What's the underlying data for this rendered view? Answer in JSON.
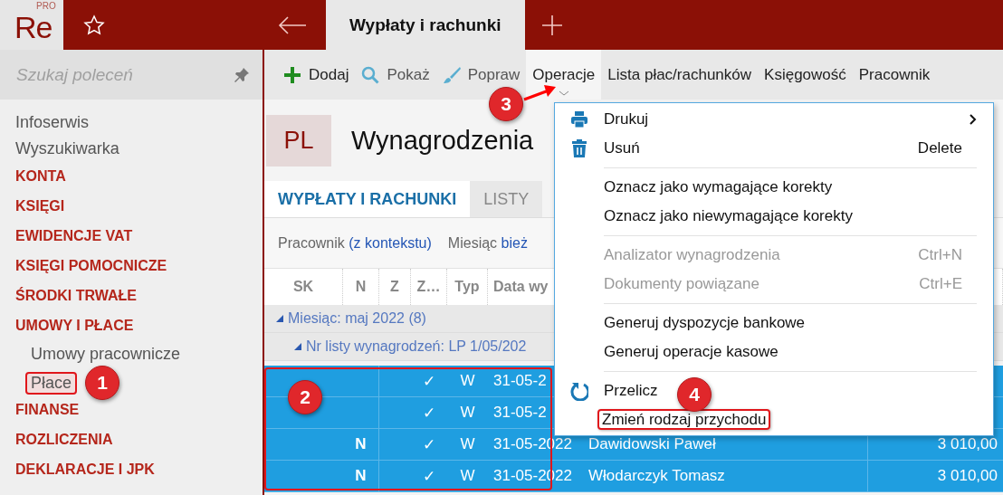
{
  "app": {
    "logo": "Re",
    "logo_badge": "PRO"
  },
  "tabs": [
    {
      "label": "Wypłaty i rachunki",
      "selected": true
    }
  ],
  "sidebar": {
    "search": {
      "placeholder": "Szukaj poleceń"
    },
    "items": [
      {
        "label": "Infoserwis",
        "kind": "link"
      },
      {
        "label": "Wyszukiwarka",
        "kind": "link"
      },
      {
        "label": "KONTA",
        "kind": "section"
      },
      {
        "label": "KSIĘGI",
        "kind": "section"
      },
      {
        "label": "EWIDENCJE VAT",
        "kind": "section"
      },
      {
        "label": "KSIĘGI POMOCNICZE",
        "kind": "section"
      },
      {
        "label": "ŚRODKI TRWAŁE",
        "kind": "section"
      },
      {
        "label": "UMOWY I PŁACE",
        "kind": "section",
        "children": [
          {
            "label": "Umowy pracownicze",
            "selected": false
          },
          {
            "label": "Płace",
            "selected": true
          }
        ]
      },
      {
        "label": "FINANSE",
        "kind": "section"
      },
      {
        "label": "ROZLICZENIA",
        "kind": "section"
      },
      {
        "label": "DEKLARACJE I JPK",
        "kind": "section"
      }
    ]
  },
  "toolbar": [
    {
      "label": "Dodaj",
      "selected": false
    },
    {
      "label": "Pokaż",
      "selected": false
    },
    {
      "label": "Popraw",
      "selected": false
    },
    {
      "label": "Operacje",
      "selected": true
    },
    {
      "label": "Lista płac/rachunków",
      "selected": false
    },
    {
      "label": "Księgowość",
      "selected": false
    },
    {
      "label": "Pracownik",
      "selected": false
    }
  ],
  "header": {
    "badge": "PL",
    "title": "Wynagrodzenia"
  },
  "view_tabs": [
    {
      "label": "WYPŁATY I RACHUNKI",
      "selected": true
    },
    {
      "label": "LISTY",
      "selected": false
    }
  ],
  "filters": [
    {
      "label": "Pracownik",
      "value": "(z kontekstu)"
    },
    {
      "label": "Miesiąc",
      "value": "bież"
    }
  ],
  "table": {
    "columns": [
      "SK",
      "N",
      "Z",
      "Z…",
      "Typ",
      "Data wy"
    ],
    "groups": [
      {
        "label": "Miesiąc: maj 2022 (8)",
        "expanded": true
      },
      {
        "label": "Nr listy wynagrodzeń: LP 1/05/202",
        "expanded": true
      }
    ],
    "rows": [
      {
        "z2": "✓",
        "typ": "W",
        "date": "31-05-2",
        "selected": true
      },
      {
        "z2": "✓",
        "typ": "W",
        "date": "31-05-2",
        "selected": true
      },
      {
        "n": "N",
        "z2": "✓",
        "typ": "W",
        "date": "31-05-2022",
        "name": "Dawidowski Paweł",
        "amount": "3 010,00",
        "selected": true
      },
      {
        "n": "N",
        "z2": "✓",
        "typ": "W",
        "date": "31-05-2022",
        "name": "Włodarczyk Tomasz",
        "amount": "3 010,00",
        "selected": true
      }
    ]
  },
  "menu": [
    {
      "kind": "item",
      "label": "Drukuj",
      "submenu": true,
      "disabled": false
    },
    {
      "kind": "item",
      "label": "Usuń",
      "shortcut": "Delete",
      "disabled": false
    },
    {
      "kind": "separator"
    },
    {
      "kind": "item",
      "label": "Oznacz jako wymagające korekty",
      "disabled": false
    },
    {
      "kind": "item",
      "label": "Oznacz jako niewymagające korekty",
      "disabled": false
    },
    {
      "kind": "separator"
    },
    {
      "kind": "item",
      "label": "Analizator wynagrodzenia",
      "shortcut": "Ctrl+N",
      "disabled": true
    },
    {
      "kind": "item",
      "label": "Dokumenty powiązane",
      "shortcut": "Ctrl+E",
      "disabled": true
    },
    {
      "kind": "separator"
    },
    {
      "kind": "item",
      "label": "Generuj dyspozycje bankowe",
      "disabled": false
    },
    {
      "kind": "item",
      "label": "Generuj operacje kasowe",
      "disabled": false
    },
    {
      "kind": "separator"
    },
    {
      "kind": "item",
      "label": "Przelicz",
      "disabled": false
    },
    {
      "kind": "item",
      "label": "Zmień rodzaj przychodu",
      "disabled": false,
      "highlighted": true
    }
  ],
  "callouts": [
    {
      "number": "1"
    },
    {
      "number": "2"
    },
    {
      "number": "3"
    },
    {
      "number": "4"
    }
  ]
}
